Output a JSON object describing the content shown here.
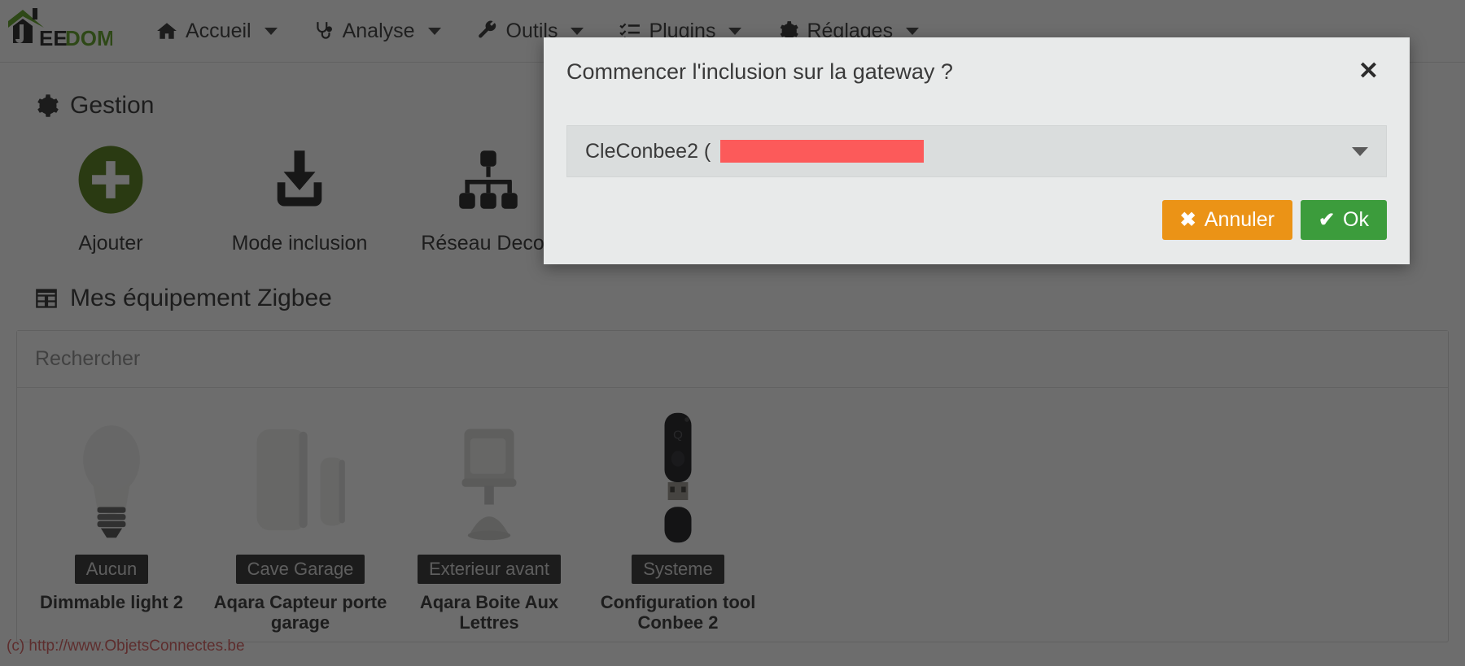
{
  "brand": {
    "name": "JEEDOM",
    "part_dark": "JEE",
    "part_green": "DOM",
    "green": "#5a9e1d"
  },
  "navbar": {
    "items": [
      {
        "label": "Accueil",
        "icon": "home-icon",
        "has_caret": true
      },
      {
        "label": "Analyse",
        "icon": "stethoscope-icon",
        "has_caret": true
      },
      {
        "label": "Outils",
        "icon": "wrench-icon",
        "has_caret": true
      },
      {
        "label": "Plugins",
        "icon": "tasks-list-icon",
        "has_caret": true
      },
      {
        "label": "Réglages",
        "icon": "gear-icon",
        "has_caret": true
      }
    ]
  },
  "gestion": {
    "title": "Gestion",
    "icon": "gear-icon",
    "actions": [
      {
        "label": "Ajouter",
        "icon": "plus-circle-icon",
        "color": "#4f7a10"
      },
      {
        "label": "Mode inclusion",
        "icon": "download-inbox-icon",
        "color": "#1d1d1d"
      },
      {
        "label": "Réseau Decon",
        "icon": "sitemap-icon",
        "color": "#1d1d1d"
      }
    ]
  },
  "equipements": {
    "title": "Mes équipement Zigbee",
    "icon": "table-icon",
    "search": {
      "placeholder": "Rechercher",
      "value": ""
    },
    "devices": [
      {
        "badge": "Aucun",
        "name": "Dimmable light 2",
        "image": "light-bulb"
      },
      {
        "badge": "Cave Garage",
        "name": "Aqara Capteur porte garage",
        "image": "door-sensor"
      },
      {
        "badge": "Exterieur avant",
        "name": "Aqara Boite Aux Lettres",
        "image": "motion-sensor"
      },
      {
        "badge": "Systeme",
        "name": "Configuration tool Conbee 2",
        "image": "usb-stick"
      }
    ]
  },
  "watermark": "(c) http://www.ObjetsConnectes.be",
  "modal": {
    "title": "Commencer l'inclusion sur la gateway ?",
    "close_label": "✕",
    "select": {
      "value": "CleConbee2 (",
      "redacted": true
    },
    "buttons": {
      "cancel": {
        "label": "Annuler",
        "glyph": "✖",
        "color": "#eb9316"
      },
      "ok": {
        "label": "Ok",
        "glyph": "✔",
        "color": "#3c9c3c"
      }
    }
  }
}
